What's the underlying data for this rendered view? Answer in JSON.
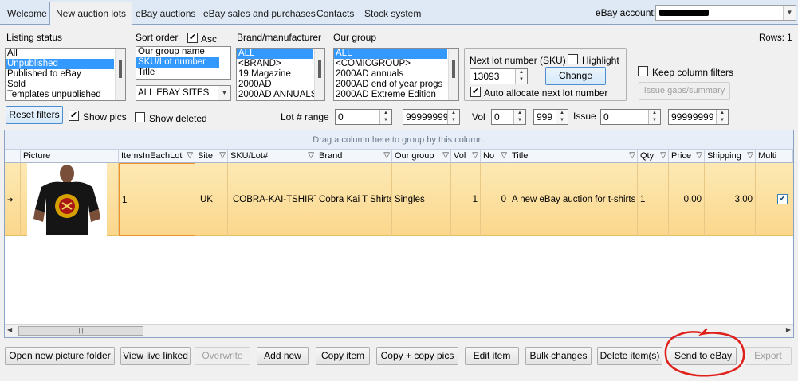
{
  "tabs": [
    "Welcome",
    "New auction lots",
    "eBay auctions",
    "eBay sales and purchases",
    "Contacts",
    "Stock system"
  ],
  "account": {
    "label": "eBay account:",
    "value": ""
  },
  "rows_label": "Rows: 1",
  "listing_status": {
    "label": "Listing status",
    "items": [
      "All",
      "Unpublished",
      "Published to eBay",
      "Sold",
      "Templates unpublished"
    ],
    "selected": "Unpublished"
  },
  "sort_order": {
    "label": "Sort order",
    "asc_label": "Asc",
    "asc_checked": true,
    "items": [
      "Our group name",
      "SKU/Lot number",
      "Title"
    ],
    "selected": "SKU/Lot number",
    "site_value": "ALL EBAY SITES"
  },
  "brand": {
    "label": "Brand/manufacturer",
    "items": [
      "ALL",
      "<BRAND>",
      "19 Magazine",
      "2000AD",
      "2000AD ANNUALS"
    ],
    "selected": "ALL"
  },
  "our_group": {
    "label": "Our group",
    "items": [
      "ALL",
      "<COMICGROUP>",
      "2000AD annuals",
      "2000AD end of year progs",
      "2000AD Extreme Edition"
    ],
    "selected": "ALL"
  },
  "next_lot": {
    "label": "Next lot number (SKU)",
    "value": "13093",
    "highlight_label": "Highlight",
    "highlight_checked": false,
    "change_label": "Change",
    "auto_label": "Auto allocate next lot number",
    "auto_checked": true
  },
  "keep_filters": {
    "label": "Keep column filters",
    "checked": false
  },
  "issue_gaps_label": "Issue gaps/summary",
  "reset_filters_label": "Reset filters",
  "show_pics": {
    "label": "Show pics",
    "checked": true
  },
  "show_deleted": {
    "label": "Show deleted",
    "checked": false
  },
  "ranges": {
    "lot_label": "Lot # range",
    "lot_from": "0",
    "lot_to": "99999999",
    "vol_label": "Vol",
    "vol_from": "0",
    "vol_to": "999",
    "issue_label": "Issue",
    "issue_from": "0",
    "issue_to": "99999999"
  },
  "grid": {
    "group_hint": "Drag a column here to group by this column.",
    "columns": [
      "Picture",
      "ItemsInEachLot",
      "Site",
      "SKU/Lot#",
      "Brand",
      "Our group",
      "Vol",
      "No",
      "Title",
      "Qty",
      "Price",
      "Shipping",
      "Multi"
    ],
    "row": {
      "items_in_each_lot": "1",
      "site": "UK",
      "sku": "COBRA-KAI-TSHIRTS",
      "brand": "Cobra Kai T Shirts",
      "our_group": "Singles",
      "vol": "1",
      "no": "0",
      "title": "A new eBay auction for t-shirts",
      "qty": "1",
      "price": "0.00",
      "shipping": "3.00",
      "multi_checked": true
    }
  },
  "buttons": [
    "Open new picture folder",
    "View live linked",
    "Overwrite",
    "Add new",
    "Copy item",
    "Copy + copy pics",
    "Edit item",
    "Bulk changes",
    "Delete item(s)",
    "Send to eBay",
    "Export"
  ],
  "colors": {
    "selection": "#3399ff",
    "row_highlight": "#fbd78c",
    "annotation": "#e0201c"
  }
}
